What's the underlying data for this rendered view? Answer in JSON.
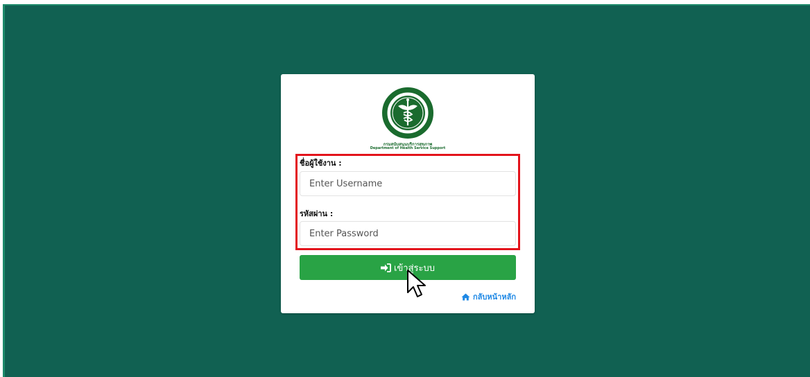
{
  "login": {
    "org_name_th": "กรมสนับสนุนบริการสุขภาพ",
    "org_name_en": "Department of Health Service Support",
    "username_label": "ชื่อผู้ใช้งาน :",
    "username_placeholder": "Enter Username",
    "password_label": "รหัสผ่าน :",
    "password_placeholder": "Enter Password",
    "login_button_label": "เข้าสู่ระบบ",
    "home_link_label": "กลับหน้าหลัก"
  },
  "icons": {
    "logo": "ministry-of-public-health-emblem",
    "login_icon": "sign-in-icon",
    "home_icon": "home-icon",
    "cursor": "mouse-pointer-icon"
  },
  "colors": {
    "background": "#116152",
    "button": "#29a345",
    "link": "#1e88e5",
    "highlight": "#e3131b"
  }
}
